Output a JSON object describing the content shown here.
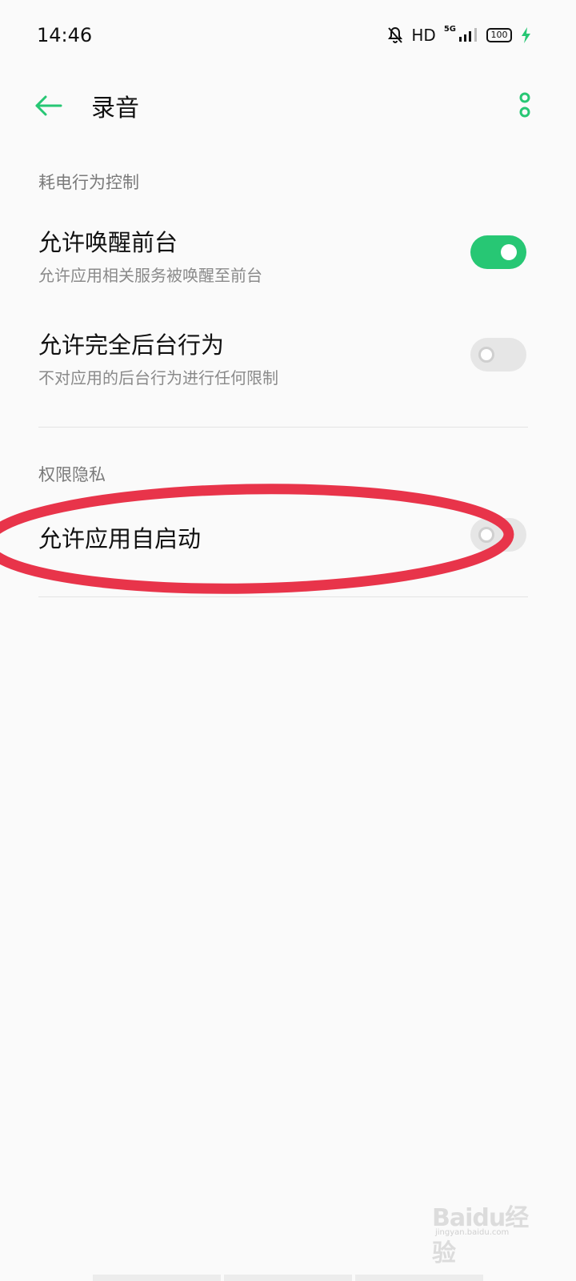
{
  "status_bar": {
    "time": "14:46",
    "hd": "HD",
    "network": "5G",
    "battery": "100",
    "icons": [
      "bell-off-icon",
      "signal-icon",
      "battery-icon",
      "charging-icon"
    ]
  },
  "app_bar": {
    "title": "录音",
    "back_icon": "arrow-left-icon",
    "more_icon": "more-vertical-icon",
    "accent_color": "#27c774"
  },
  "sections": {
    "power": {
      "header": "耗电行为控制",
      "items": [
        {
          "title": "允许唤醒前台",
          "subtitle": "允许应用相关服务被唤醒至前台",
          "enabled": true
        },
        {
          "title": "允许完全后台行为",
          "subtitle": "不对应用的后台行为进行任何限制",
          "enabled": false
        }
      ]
    },
    "privacy": {
      "header": "权限隐私",
      "items": [
        {
          "title": "允许应用自启动",
          "enabled": false
        }
      ]
    }
  },
  "annotation": {
    "color": "#e8344a"
  },
  "watermark": {
    "text": "Baidu经验",
    "sub": "jingyan.baidu.com"
  }
}
